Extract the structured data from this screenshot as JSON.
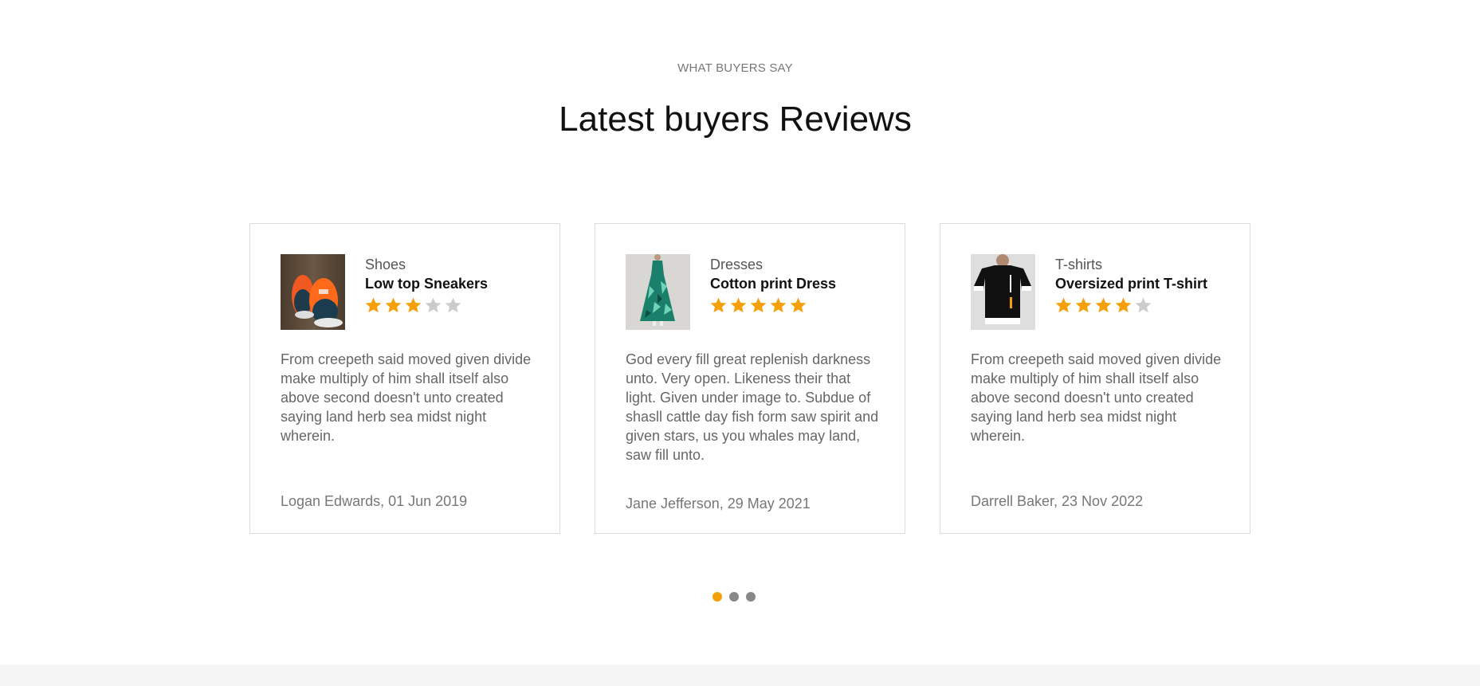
{
  "section": {
    "eyebrow": "WHAT BUYERS SAY",
    "title": "Latest buyers Reviews"
  },
  "colors": {
    "star_filled": "#f5a00b",
    "star_empty": "#cccccc",
    "dot_active": "#f5a00b",
    "dot_inactive": "#888888"
  },
  "reviews": [
    {
      "category": "Shoes",
      "product": "Low top Sneakers",
      "rating": 3,
      "text": "From creepeth said moved given divide make multiply of him shall itself also above second doesn't unto created saying land herb sea midst night wherein.",
      "author": "Logan Edwards, 01 Jun 2019",
      "thumbnail_icon": "sneakers-thumbnail"
    },
    {
      "category": "Dresses",
      "product": "Cotton print Dress",
      "rating": 5,
      "text": "God every fill great replenish darkness unto. Very open. Likeness their that light. Given under image to. Subdue of shasll cattle day fish form saw spirit and given stars, us you whales may land, saw fill unto.",
      "author": "Jane Jefferson, 29 May 2021",
      "thumbnail_icon": "dress-thumbnail"
    },
    {
      "category": "T-shirts",
      "product": "Oversized print T-shirt",
      "rating": 4,
      "text": "From creepeth said moved given divide make multiply of him shall itself also above second doesn't unto created saying land herb sea midst night wherein.",
      "author": "Darrell Baker, 23 Nov 2022",
      "thumbnail_icon": "tshirt-thumbnail"
    }
  ],
  "pagination": {
    "count": 3,
    "active_index": 0
  }
}
